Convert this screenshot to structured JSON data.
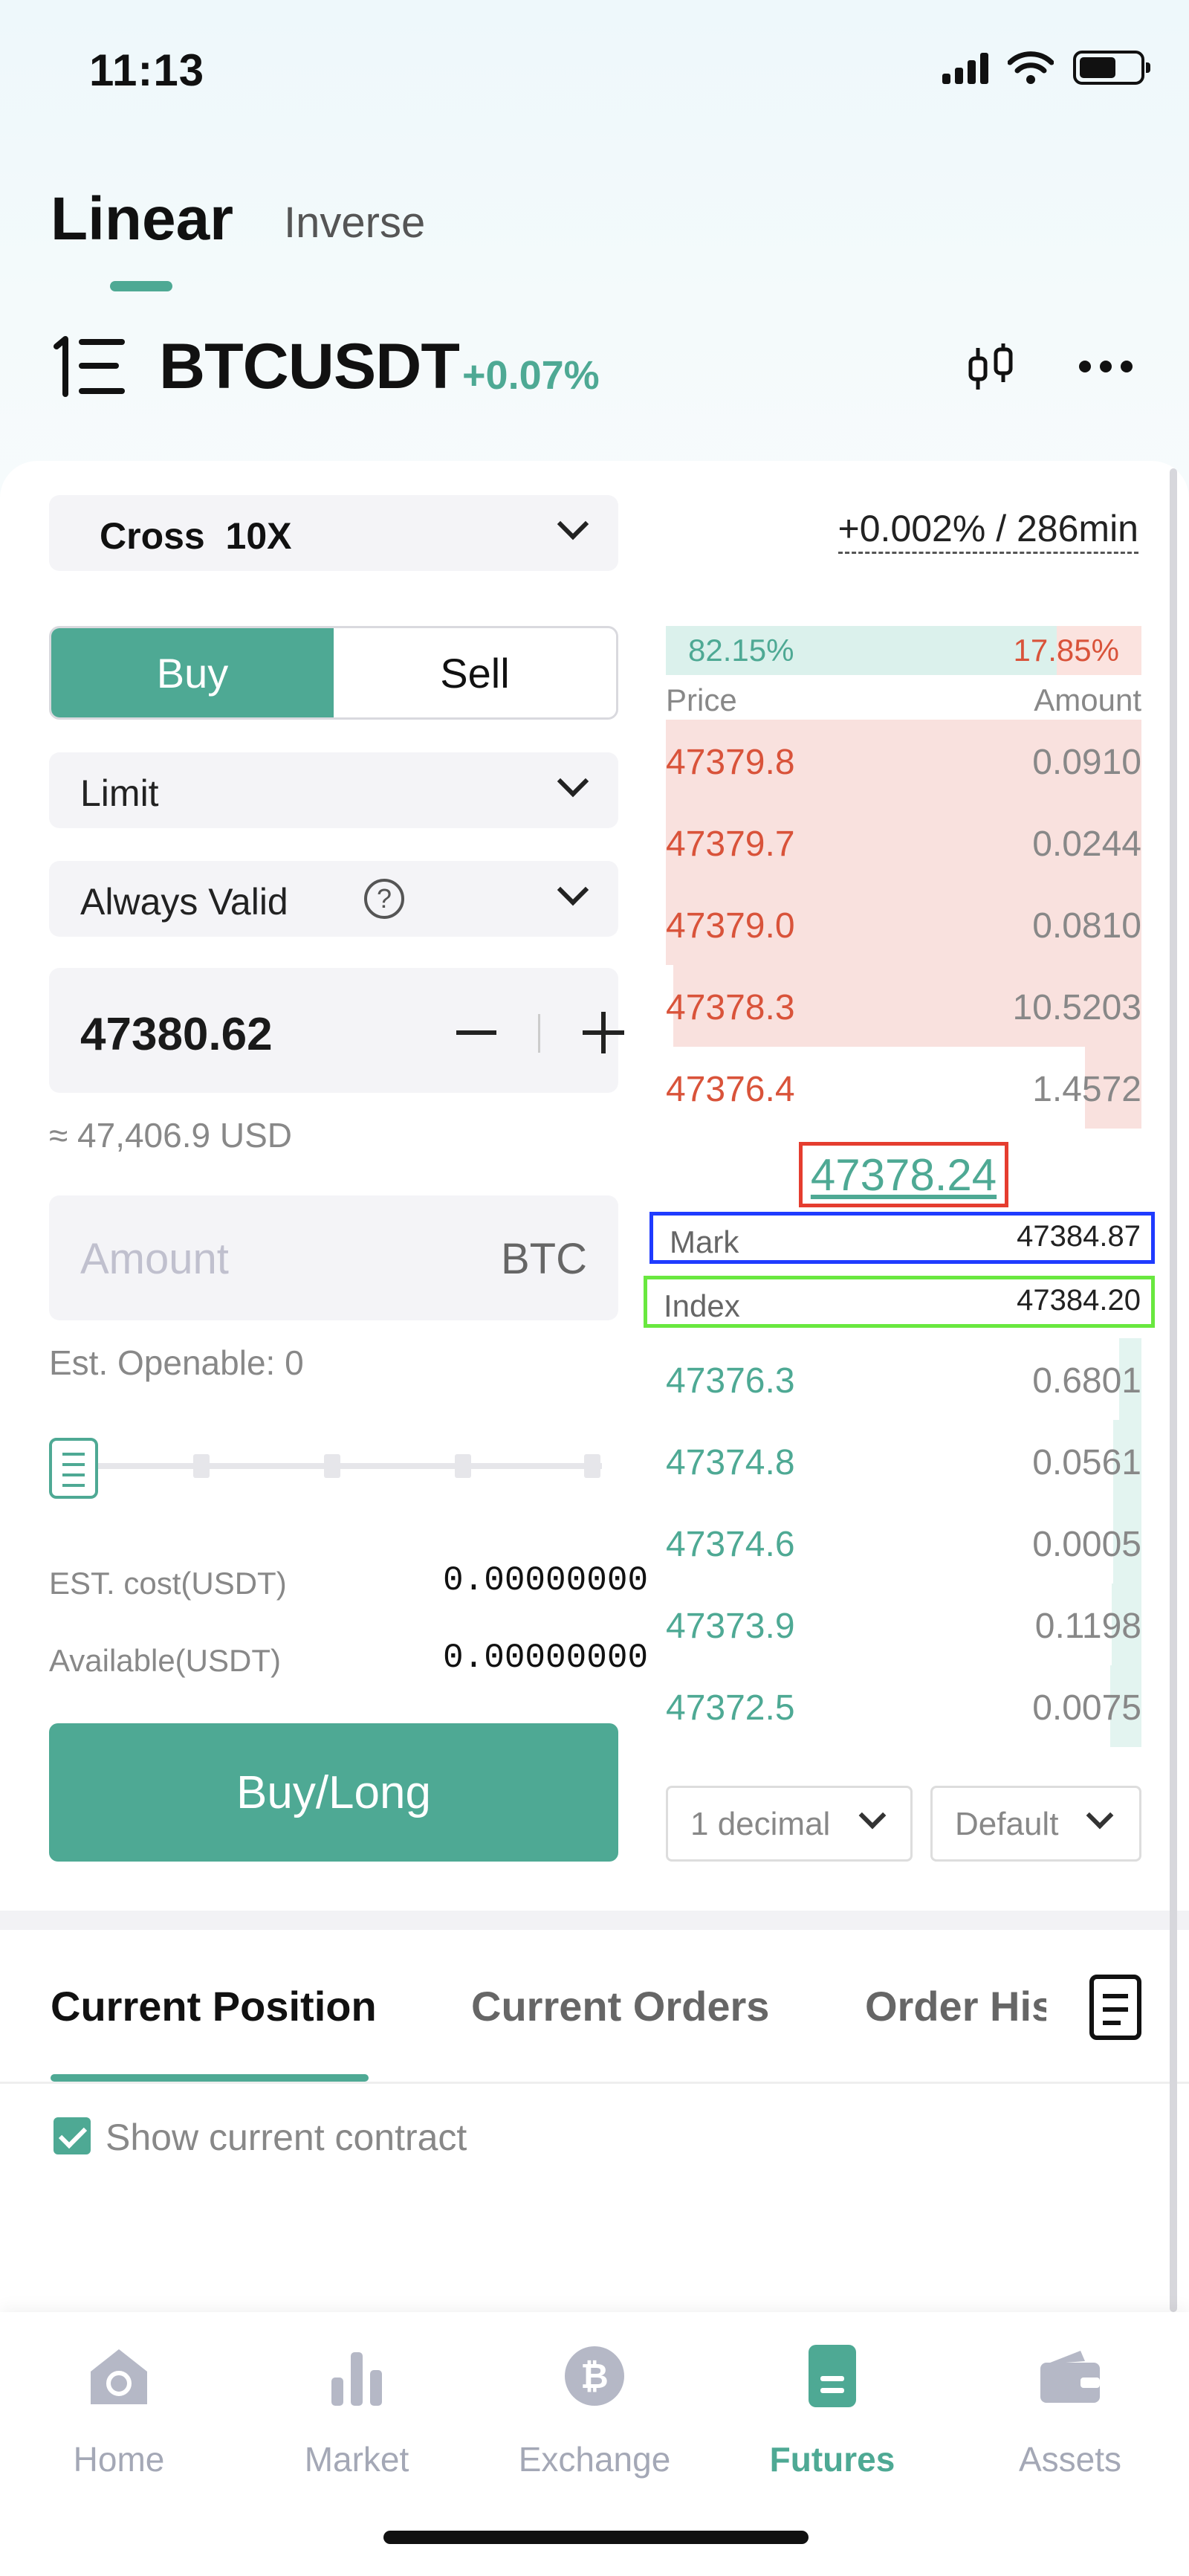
{
  "status_bar": {
    "time": "11:13"
  },
  "header": {
    "tabs": [
      {
        "label": "Linear",
        "active": true
      },
      {
        "label": "Inverse",
        "active": false
      }
    ],
    "symbol": "BTCUSDT",
    "change": "+0.07%"
  },
  "order_form": {
    "margin_mode": "Cross",
    "leverage": "10X",
    "funding": "+0.002% / 286min",
    "side_buy": "Buy",
    "side_sell": "Sell",
    "order_type": "Limit",
    "validity": "Always Valid",
    "validity_help": "?",
    "price": "47380.62",
    "price_usd": "≈ 47,406.9 USD",
    "amount_placeholder": "Amount",
    "amount_unit": "BTC",
    "est_openable": "Est. Openable: 0",
    "slider_value": 0,
    "est_cost_label": "EST. cost(USDT)",
    "est_cost_value": "0.00000000",
    "available_label": "Available(USDT)",
    "available_value": "0.00000000",
    "submit_label": "Buy/Long"
  },
  "orderbook": {
    "buy_ratio": "82.15%",
    "sell_ratio": "17.85%",
    "price_header": "Price",
    "amount_header": "Amount",
    "asks": [
      {
        "price": "47379.8",
        "amount": "0.0910"
      },
      {
        "price": "47379.7",
        "amount": "0.0244"
      },
      {
        "price": "47379.0",
        "amount": "0.0810"
      },
      {
        "price": "47378.3",
        "amount": "10.5203"
      },
      {
        "price": "47376.4",
        "amount": "1.4572"
      }
    ],
    "last_price": "47378.24",
    "mark_label": "Mark",
    "mark_price": "47384.87",
    "index_label": "Index",
    "index_price": "47384.20",
    "bids": [
      {
        "price": "47376.3",
        "amount": "0.6801"
      },
      {
        "price": "47374.8",
        "amount": "0.0561"
      },
      {
        "price": "47374.6",
        "amount": "0.0005"
      },
      {
        "price": "47373.9",
        "amount": "0.1198"
      },
      {
        "price": "47372.5",
        "amount": "0.0075"
      }
    ],
    "decimal_select": "1 decimal",
    "view_select": "Default"
  },
  "positions": {
    "tabs": [
      {
        "label": "Current Position",
        "active": true
      },
      {
        "label": "Current Orders",
        "active": false
      },
      {
        "label": "Order His",
        "active": false
      }
    ],
    "show_current_contract": "Show current contract"
  },
  "bottom_nav": [
    {
      "label": "Home",
      "icon": "home-icon",
      "active": false
    },
    {
      "label": "Market",
      "icon": "market-icon",
      "active": false
    },
    {
      "label": "Exchange",
      "icon": "exchange-icon",
      "active": false
    },
    {
      "label": "Futures",
      "icon": "futures-icon",
      "active": true
    },
    {
      "label": "Assets",
      "icon": "assets-icon",
      "active": false
    }
  ],
  "colors": {
    "accent": "#4ea994",
    "ask": "#d9533a",
    "highlight_red": "#e53d2f",
    "highlight_blue": "#1f3bff",
    "highlight_green": "#69e83f"
  }
}
